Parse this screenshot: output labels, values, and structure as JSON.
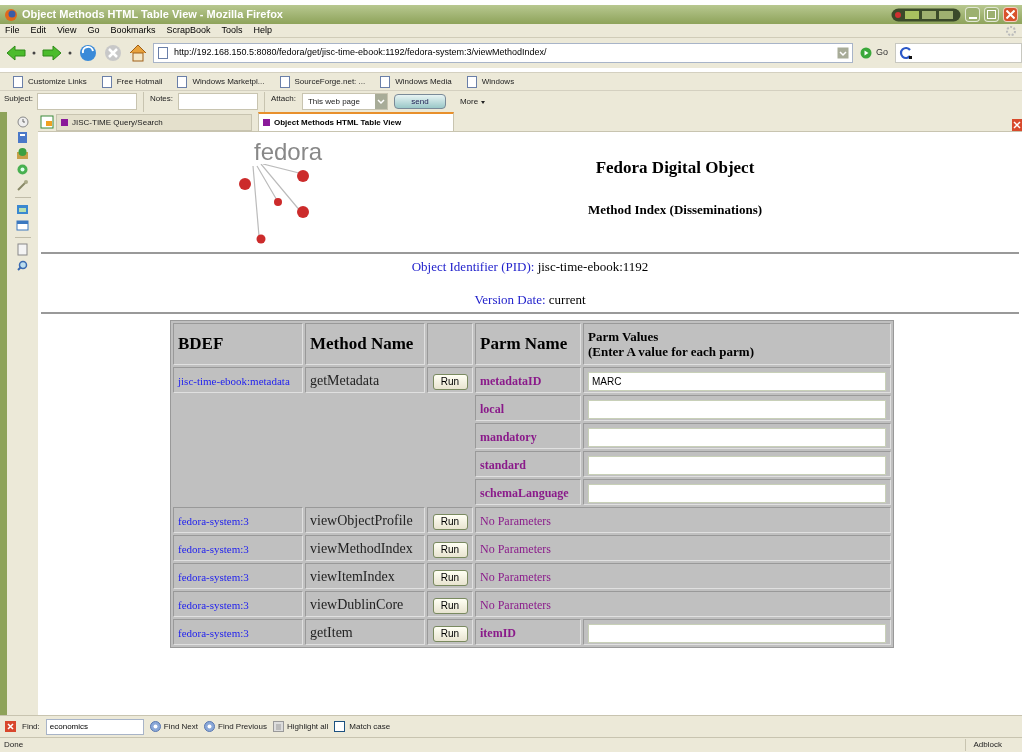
{
  "window": {
    "title": "Object Methods HTML Table View - Mozilla Firefox"
  },
  "menu": [
    "File",
    "Edit",
    "View",
    "Go",
    "Bookmarks",
    "ScrapBook",
    "Tools",
    "Help"
  ],
  "address": {
    "url": "http://192.168.150.5:8080/fedora/get/jisc-time-ebook:1192/fedora-system:3/viewMethodIndex/",
    "go": "Go"
  },
  "bookmarks": [
    "Customize Links",
    "Free Hotmail",
    "Windows Marketpl...",
    "SourceForge.net: ...",
    "Windows Media",
    "Windows"
  ],
  "form_bar": {
    "subject_label": "Subject:",
    "notes_label": "Notes:",
    "attach_label": "Attach:",
    "attach_value": "This web page",
    "send": "send",
    "more": "More"
  },
  "tabs": [
    {
      "label": "JISC-TIME Query/Search",
      "selected": false
    },
    {
      "label": "Object Methods HTML Table View",
      "selected": true
    }
  ],
  "page": {
    "logo_text": "fedora",
    "heading": "Fedora Digital Object",
    "subheading": "Method Index (Disseminations)",
    "pid_label": "Object Identifier (PID):",
    "pid": "jisc-time-ebook:1192",
    "version_label": "Version Date:",
    "version": "current"
  },
  "table": {
    "columns": [
      "BDEF",
      "Method Name",
      "",
      "Parm Name",
      "Parm Values\n(Enter A value for each parm)"
    ],
    "rows": [
      {
        "bdef": "jisc-time-ebook:metadata",
        "method": "getMetadata",
        "run": "Run",
        "params": [
          {
            "name": "metadataID",
            "value": "MARC"
          },
          {
            "name": "local"
          },
          {
            "name": "mandatory"
          },
          {
            "name": "standard"
          },
          {
            "name": "schemaLanguage"
          }
        ]
      },
      {
        "bdef": "fedora-system:3",
        "method": "viewObjectProfile",
        "run": "Run",
        "no_params": "No Parameters"
      },
      {
        "bdef": "fedora-system:3",
        "method": "viewMethodIndex",
        "run": "Run",
        "no_params": "No Parameters"
      },
      {
        "bdef": "fedora-system:3",
        "method": "viewItemIndex",
        "run": "Run",
        "no_params": "No Parameters"
      },
      {
        "bdef": "fedora-system:3",
        "method": "viewDublinCore",
        "run": "Run",
        "no_params": "No Parameters"
      },
      {
        "bdef": "fedora-system:3",
        "method": "getItem",
        "run": "Run",
        "params": [
          {
            "name": "itemID"
          }
        ]
      }
    ]
  },
  "find_bar": {
    "label": "Find:",
    "value": "economics",
    "next": "Find Next",
    "previous": "Find Previous",
    "highlight": "Highlight all",
    "match_case": {
      "label": "Match case",
      "checked": false
    }
  },
  "status_bar": {
    "text": "Done",
    "adblock": "Adblock"
  }
}
